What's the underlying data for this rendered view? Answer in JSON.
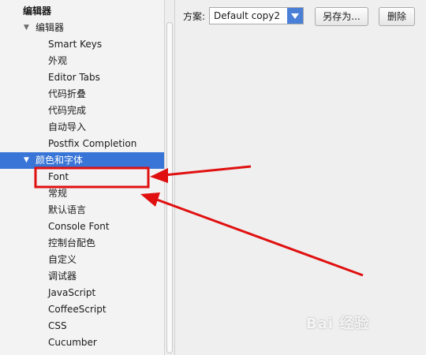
{
  "sidebar": {
    "items": [
      {
        "label": "编辑器",
        "level": 0,
        "arrow": ""
      },
      {
        "label": "编辑器",
        "level": 1,
        "arrow": "▼"
      },
      {
        "label": "Smart Keys",
        "level": 2,
        "arrow": ""
      },
      {
        "label": "外观",
        "level": 2,
        "arrow": ""
      },
      {
        "label": "Editor Tabs",
        "level": 2,
        "arrow": ""
      },
      {
        "label": "代码折叠",
        "level": 2,
        "arrow": ""
      },
      {
        "label": "代码完成",
        "level": 2,
        "arrow": ""
      },
      {
        "label": "自动导入",
        "level": 2,
        "arrow": ""
      },
      {
        "label": "Postfix Completion",
        "level": 2,
        "arrow": ""
      },
      {
        "label": "颜色和字体",
        "level": 1,
        "arrow": "▼",
        "selected": true
      },
      {
        "label": "Font",
        "level": 2,
        "arrow": "",
        "highlighted": true
      },
      {
        "label": "常规",
        "level": 2,
        "arrow": ""
      },
      {
        "label": "默认语言",
        "level": 2,
        "arrow": ""
      },
      {
        "label": "Console Font",
        "level": 2,
        "arrow": ""
      },
      {
        "label": "控制台配色",
        "level": 2,
        "arrow": ""
      },
      {
        "label": "自定义",
        "level": 2,
        "arrow": ""
      },
      {
        "label": "调试器",
        "level": 2,
        "arrow": ""
      },
      {
        "label": "JavaScript",
        "level": 2,
        "arrow": ""
      },
      {
        "label": "CoffeeScript",
        "level": 2,
        "arrow": ""
      },
      {
        "label": "CSS",
        "level": 2,
        "arrow": ""
      },
      {
        "label": "Cucumber",
        "level": 2,
        "arrow": ""
      }
    ]
  },
  "scheme": {
    "label": "方案:",
    "value": "Default copy2"
  },
  "buttons": {
    "save_as": "另存为...",
    "delete": "删除"
  },
  "watermark": "Bai 经验",
  "colors": {
    "selection": "#3875d7",
    "annotation": "#e01010",
    "dropdown": "#4a7fd8"
  }
}
